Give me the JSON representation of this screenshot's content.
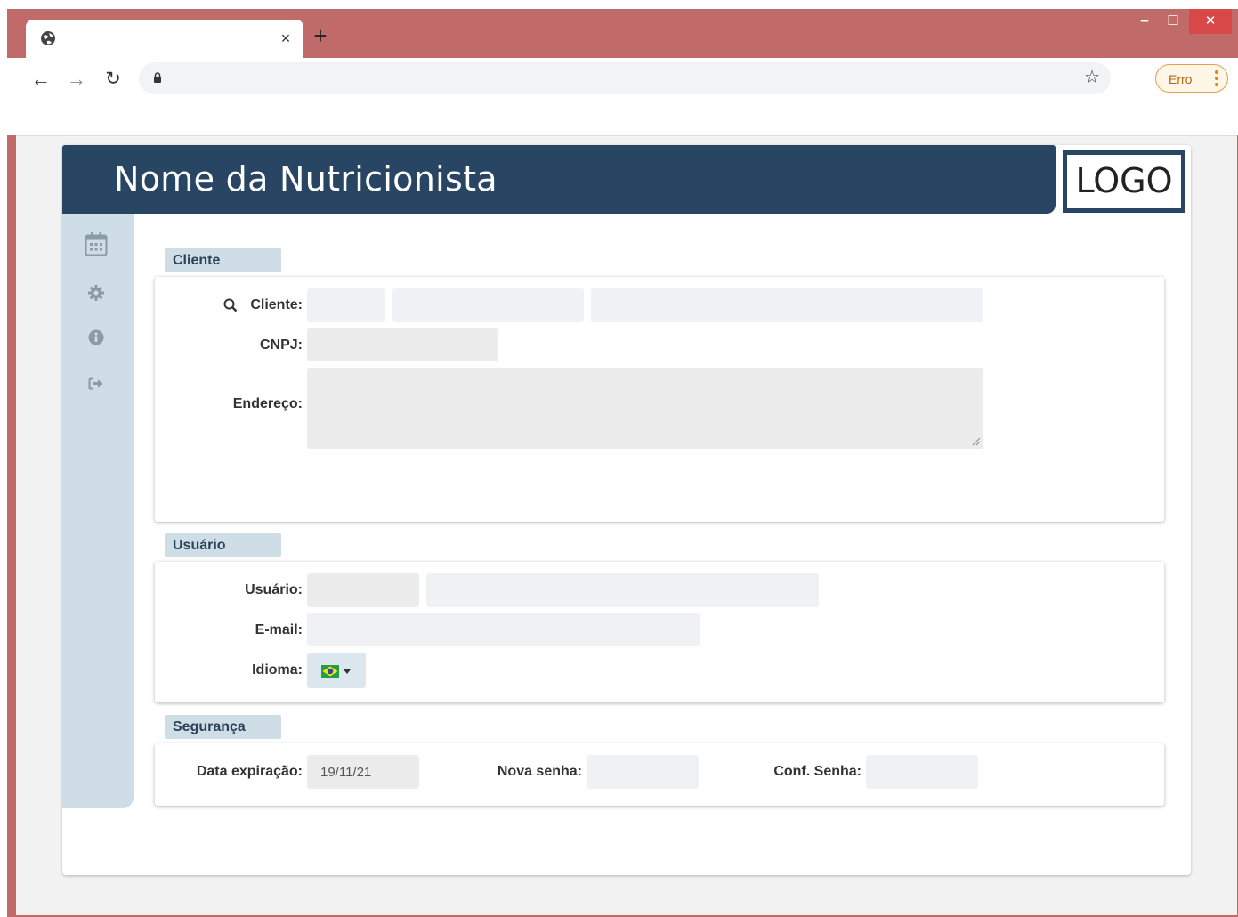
{
  "browser": {
    "tab_title": "",
    "tab_close": "×",
    "new_tab": "+",
    "address": "",
    "error_label": "Erro",
    "win_minimize": "‒",
    "win_maximize": "☐",
    "win_close": "✕"
  },
  "header": {
    "title": "Nome da Nutricionista",
    "logo": "LOGO"
  },
  "sidebar": {
    "items": [
      {
        "icon": "calendar-icon"
      },
      {
        "icon": "gear-icon"
      },
      {
        "icon": "info-icon"
      },
      {
        "icon": "sign-out-icon"
      }
    ]
  },
  "cliente": {
    "section_title": "Cliente",
    "cliente_label": "Cliente:",
    "cliente_code": "",
    "cliente_doc": "",
    "cliente_name": "",
    "cnpj_label": "CNPJ:",
    "cnpj_value": "",
    "endereco_label": "Endereço:",
    "endereco_value": ""
  },
  "usuario": {
    "section_title": "Usuário",
    "usuario_label": "Usuário:",
    "usuario_login": "",
    "usuario_name": "",
    "email_label": "E-mail:",
    "email_value": "",
    "idioma_label": "Idioma:",
    "idioma_value": "Português (Brasil)"
  },
  "seguranca": {
    "section_title": "Segurança",
    "data_expiracao_label": "Data expiração:",
    "data_expiracao_value": "19/11/21",
    "nova_senha_label": "Nova senha:",
    "nova_senha_value": "",
    "conf_senha_label": "Conf. Senha:",
    "conf_senha_value": ""
  },
  "colors": {
    "banner": "#284663",
    "sidebar": "#cfdde6",
    "browser_frame": "#c06a6a"
  }
}
